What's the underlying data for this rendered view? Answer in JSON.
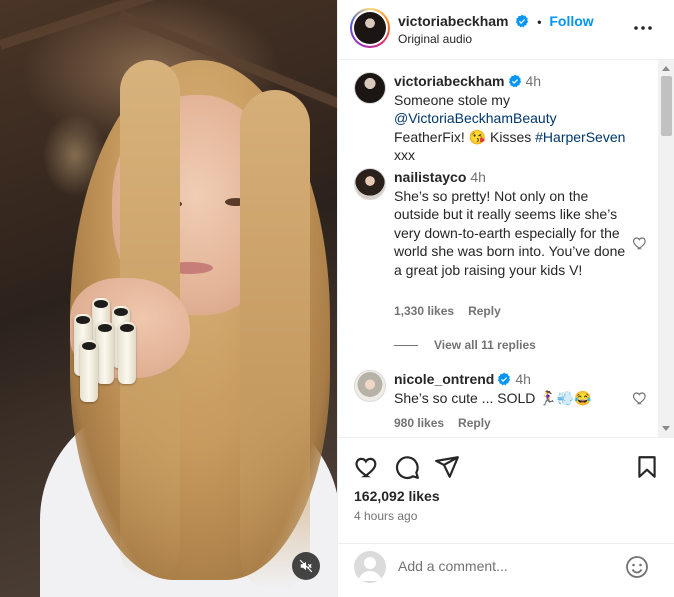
{
  "post": {
    "author": "victoriabeckham",
    "follow_label": "Follow",
    "audio": "Original audio",
    "likes": "162,092 likes",
    "posted_ago": "4 hours ago"
  },
  "caption": {
    "username": "victoriabeckham",
    "time": "4h",
    "text_1": "Someone stole my ",
    "mention": "@VictoriaBeckhamBeauty",
    "text_2": " FeatherFix! 😘 Kisses ",
    "hashtag": "#HarperSeven",
    "text_3": " xxx"
  },
  "comments": [
    {
      "username": "nailistayco",
      "time": "4h",
      "text": "She’s so pretty! Not only on the outside but it really seems like she’s very down-to-earth especially for the world she was born into. You’ve done a great job raising your kids V!",
      "likes": "1,330 likes",
      "reply": "Reply",
      "view_replies": "View all 11 replies"
    },
    {
      "username": "nicole_ontrend",
      "time": "4h",
      "text": "She’s so cute ... SOLD 🏃‍♀️💨😂",
      "likes": "980 likes",
      "reply": "Reply"
    }
  ],
  "composer": {
    "placeholder": "Add a comment..."
  },
  "icons": {
    "verified": "verified-badge-icon",
    "more": "more-options-icon",
    "like": "heart-icon",
    "comment": "comment-icon",
    "share": "send-icon",
    "save": "bookmark-icon",
    "emoji": "emoji-icon",
    "mute": "muted-speaker-icon"
  },
  "colors": {
    "link": "#00376b",
    "follow": "#0095f6",
    "verified": "#0095f6",
    "muted_text": "#737373"
  }
}
